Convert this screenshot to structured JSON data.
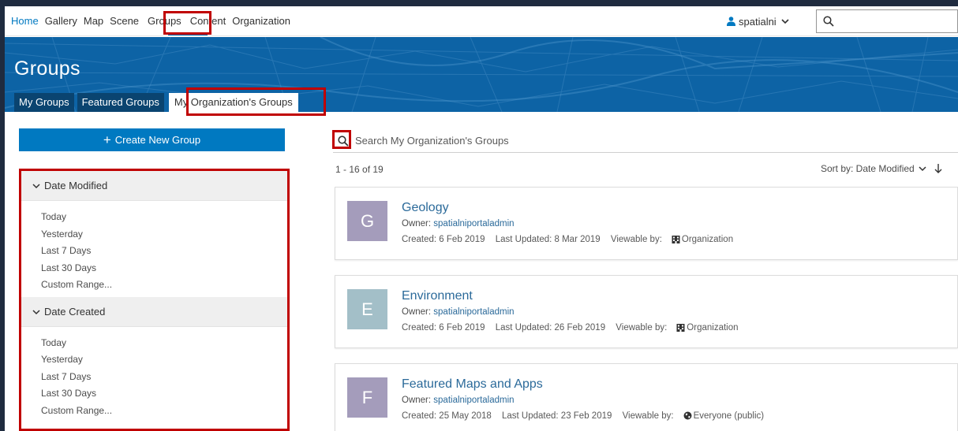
{
  "nav": {
    "links": [
      "Home",
      "Gallery",
      "Map",
      "Scene",
      "Groups",
      "Content",
      "Organization"
    ],
    "active": "Groups",
    "username": "spatialni"
  },
  "banner": {
    "title": "Groups",
    "tabs": [
      "My Groups",
      "Featured Groups",
      "My Organization's Groups"
    ],
    "active_tab": "My Organization's Groups"
  },
  "sidebar": {
    "create_label": "Create New Group",
    "filters": [
      {
        "heading": "Date Modified",
        "items": [
          "Today",
          "Yesterday",
          "Last 7 Days",
          "Last 30 Days",
          "Custom Range..."
        ]
      },
      {
        "heading": "Date Created",
        "items": [
          "Today",
          "Yesterday",
          "Last 7 Days",
          "Last 30 Days",
          "Custom Range..."
        ]
      }
    ]
  },
  "main": {
    "search_placeholder": "Search My Organization's Groups",
    "count": "1 - 16 of 19",
    "sort_label": "Sort by: Date Modified",
    "groups": [
      {
        "letter": "G",
        "title": "Geology",
        "owner_label": "Owner:",
        "owner": "spatialniportaladmin",
        "created": "Created: 6 Feb 2019",
        "updated": "Last Updated: 8 Mar 2019",
        "viewable_label": "Viewable by:",
        "viewable": "Organization",
        "viewable_icon": "building-icon",
        "thumb_color": "#a49cbb"
      },
      {
        "letter": "E",
        "title": "Environment",
        "owner_label": "Owner:",
        "owner": "spatialniportaladmin",
        "created": "Created: 6 Feb 2019",
        "updated": "Last Updated: 26 Feb 2019",
        "viewable_label": "Viewable by:",
        "viewable": "Organization",
        "viewable_icon": "building-icon",
        "thumb_color": "#a3bfc8"
      },
      {
        "letter": "F",
        "title": "Featured Maps and Apps",
        "owner_label": "Owner:",
        "owner": "spatialniportaladmin",
        "created": "Created: 25 May 2018",
        "updated": "Last Updated: 23 Feb 2019",
        "viewable_label": "Viewable by:",
        "viewable": "Everyone (public)",
        "viewable_icon": "globe-icon",
        "thumb_color": "#a49cbb"
      }
    ]
  },
  "colors": {
    "accent": "#0079c1",
    "highlight": "#c00000",
    "banner": "#0d63a5"
  }
}
